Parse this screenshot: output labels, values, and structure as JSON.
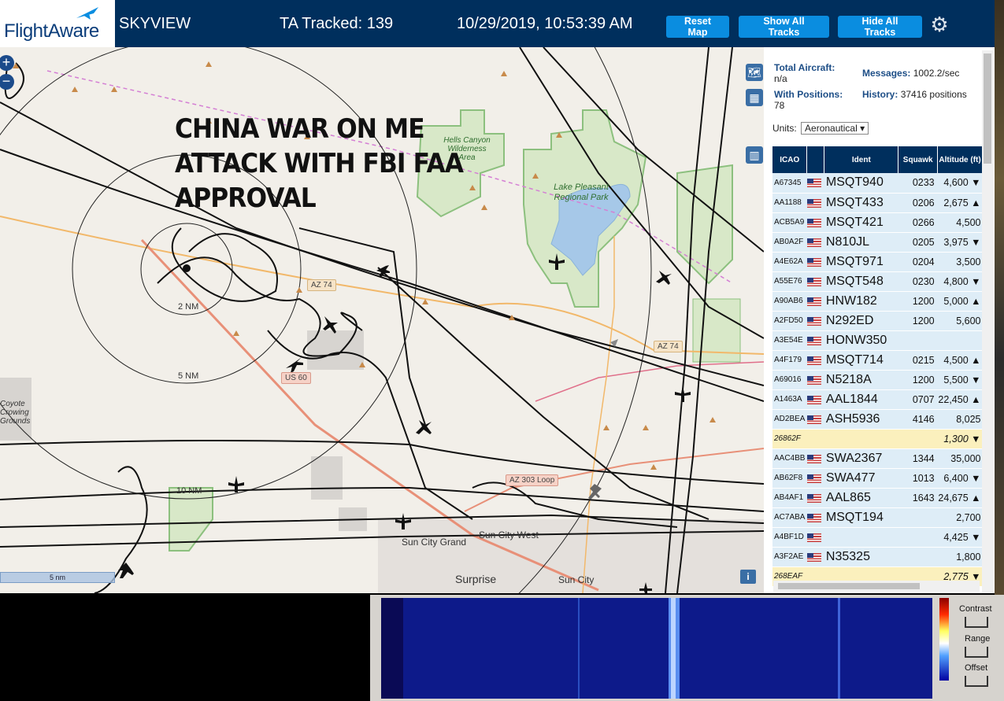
{
  "header": {
    "logo": "FlightAware",
    "title": "SKYVIEW",
    "tracked": "TA Tracked: 139",
    "datetime": "10/29/2019, 10:53:39 AM",
    "buttons": {
      "reset": "Reset Map",
      "show": "Show All Tracks",
      "hide": "Hide All Tracks"
    },
    "settings_icon": "gear-icon"
  },
  "map": {
    "overlay_lines": [
      "CHINA WAR ON ME",
      "ATTACK WITH FBI FAA",
      "APPROVAL"
    ],
    "range_rings": [
      "2 NM",
      "5 NM",
      "10 NM"
    ],
    "places": {
      "hells_canyon": "Hells Canyon Wilderness Area",
      "lake_pleasant": "Lake Pleasant Regional Park",
      "sun_city_grand": "Sun City Grand",
      "sun_city_west": "Sun City West",
      "surprise": "Surprise",
      "sun_city": "Sun City",
      "coyote": "Coyote Crowing Grounds"
    },
    "shields": {
      "az74_west": "AZ 74",
      "az74_east": "AZ 74",
      "us60": "US 60",
      "az303": "AZ 303 Loop"
    },
    "scale": "5 nm",
    "info": "i",
    "zoom_in": "+",
    "zoom_out": "−"
  },
  "sidebar": {
    "total_aircraft_label": "Total Aircraft:",
    "total_aircraft_value": "n/a",
    "messages_label": "Messages:",
    "messages_value": "1002.2/sec",
    "with_positions_label": "With Positions:",
    "with_positions_value": "78",
    "history_label": "History:",
    "history_value": "37416 positions",
    "units_label": "Units:",
    "units_value": "Aeronautical",
    "columns": [
      "ICAO",
      "",
      "Ident",
      "Squawk",
      "Altitude (ft)"
    ],
    "rows": [
      {
        "icao": "A67345",
        "flag": true,
        "ident": "MSQT940",
        "squawk": "0233",
        "alt": "4,600 ▼",
        "style": "r"
      },
      {
        "icao": "AA1188",
        "flag": true,
        "ident": "MSQT433",
        "squawk": "0206",
        "alt": "2,675 ▲",
        "style": "r"
      },
      {
        "icao": "ACB5A9",
        "flag": true,
        "ident": "MSQT421",
        "squawk": "0266",
        "alt": "4,500",
        "style": "r"
      },
      {
        "icao": "AB0A2F",
        "flag": true,
        "ident": "N810JL",
        "squawk": "0205",
        "alt": "3,975 ▼",
        "style": "r"
      },
      {
        "icao": "A4E62A",
        "flag": true,
        "ident": "MSQT971",
        "squawk": "0204",
        "alt": "3,500",
        "style": "r"
      },
      {
        "icao": "A55E76",
        "flag": true,
        "ident": "MSQT548",
        "squawk": "0230",
        "alt": "4,800 ▼",
        "style": "r"
      },
      {
        "icao": "A90AB6",
        "flag": true,
        "ident": "HNW182",
        "squawk": "1200",
        "alt": "5,000 ▲",
        "style": "r"
      },
      {
        "icao": "A2FD50",
        "flag": true,
        "ident": "N292ED",
        "squawk": "1200",
        "alt": "5,600",
        "style": "r"
      },
      {
        "icao": "A3E54E",
        "flag": true,
        "ident": "HONW350",
        "squawk": "",
        "alt": "",
        "style": "r"
      },
      {
        "icao": "A4F179",
        "flag": true,
        "ident": "MSQT714",
        "squawk": "0215",
        "alt": "4,500 ▲",
        "style": "r"
      },
      {
        "icao": "A69016",
        "flag": true,
        "ident": "N5218A",
        "squawk": "1200",
        "alt": "5,500 ▼",
        "style": "r"
      },
      {
        "icao": "A1463A",
        "flag": true,
        "ident": "AAL1844",
        "squawk": "0707",
        "alt": "22,450 ▲",
        "style": "r"
      },
      {
        "icao": "AD2BEA",
        "flag": true,
        "ident": "ASH5936",
        "squawk": "4146",
        "alt": "8,025",
        "style": "r"
      },
      {
        "icao": "26862F",
        "flag": false,
        "ident": "",
        "squawk": "",
        "alt": "1,300 ▼",
        "style": "y"
      },
      {
        "icao": "AAC4BB",
        "flag": true,
        "ident": "SWA2367",
        "squawk": "1344",
        "alt": "35,000",
        "style": "r"
      },
      {
        "icao": "AB62F8",
        "flag": true,
        "ident": "SWA477",
        "squawk": "1013",
        "alt": "6,400 ▼",
        "style": "r"
      },
      {
        "icao": "AB4AF1",
        "flag": true,
        "ident": "AAL865",
        "squawk": "1643",
        "alt": "24,675 ▲",
        "style": "r"
      },
      {
        "icao": "AC7ABA",
        "flag": true,
        "ident": "MSQT194",
        "squawk": "",
        "alt": "2,700",
        "style": "r"
      },
      {
        "icao": "A4BF1D",
        "flag": true,
        "ident": "",
        "squawk": "",
        "alt": "4,425 ▼",
        "style": "r"
      },
      {
        "icao": "A3F2AE",
        "flag": true,
        "ident": "N35325",
        "squawk": "",
        "alt": "1,800",
        "style": "r"
      },
      {
        "icao": "268EAF",
        "flag": false,
        "ident": "",
        "squawk": "",
        "alt": "2,775 ▼",
        "style": "y"
      }
    ]
  },
  "waterfall": {
    "contrast": "Contrast",
    "range": "Range",
    "offset": "Offset"
  }
}
